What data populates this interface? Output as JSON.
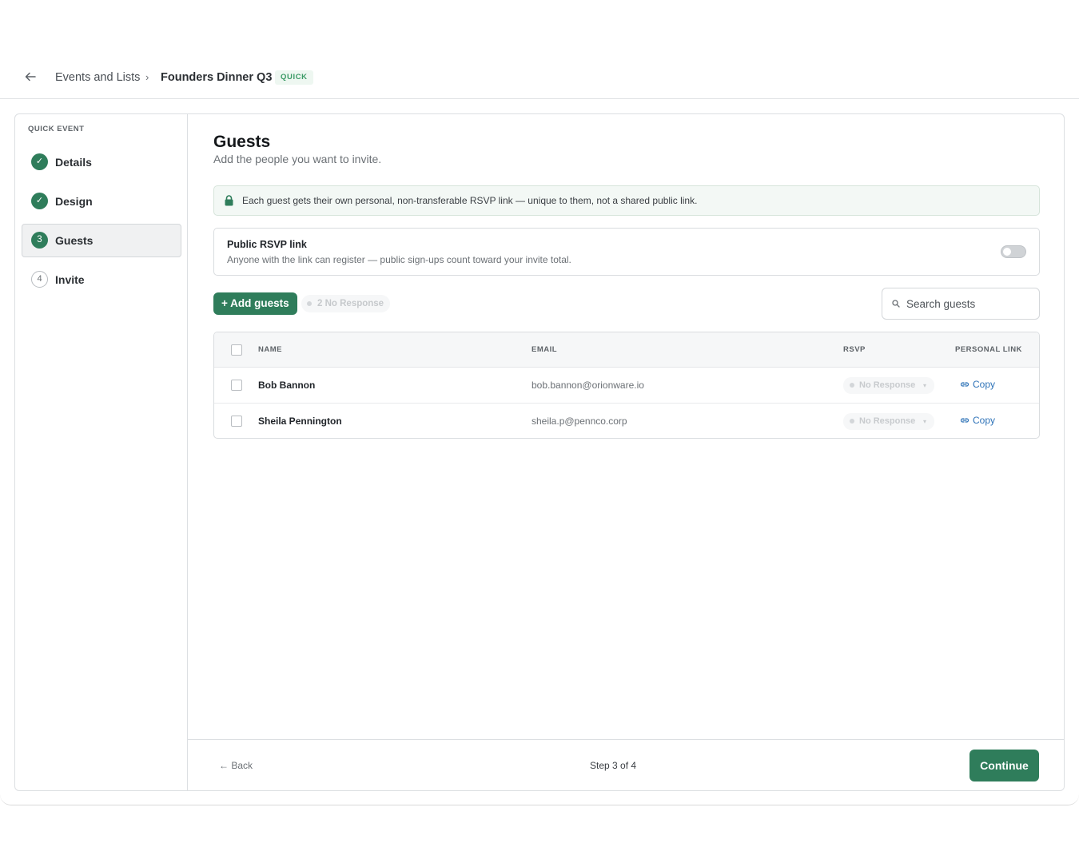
{
  "header": {
    "breadcrumb_root": "Events and Lists",
    "breadcrumb_sep": "›",
    "breadcrumb_current": "Founders Dinner Q3",
    "badge": "QUICK"
  },
  "sidebar": {
    "title": "QUICK EVENT",
    "steps": [
      {
        "label": "Details",
        "state": "done",
        "marker": "✓"
      },
      {
        "label": "Design",
        "state": "done",
        "marker": "✓"
      },
      {
        "label": "Guests",
        "state": "current",
        "marker": "3"
      },
      {
        "label": "Invite",
        "state": "todo",
        "marker": "4"
      }
    ]
  },
  "main": {
    "title": "Guests",
    "subtitle": "Add the people you want to invite.",
    "notice": "Each guest gets their own personal, non-transferable RSVP link — unique to them, not a shared public link.",
    "public_rsvp": {
      "title": "Public RSVP link",
      "description": "Anyone with the link can register — public sign-ups count toward your invite total.",
      "enabled": false
    },
    "add_button": "+ Add guests",
    "filter_pill": "2 No Response",
    "search": {
      "placeholder": "Search guests"
    },
    "table": {
      "columns": [
        "NAME",
        "EMAIL",
        "RSVP",
        "PERSONAL LINK"
      ],
      "rows": [
        {
          "name": "Bob Bannon",
          "email": "bob.bannon@orionware.io",
          "rsvp": "No Response",
          "link": "Copy"
        },
        {
          "name": "Sheila Pennington",
          "email": "sheila.p@pennco.corp",
          "rsvp": "No Response",
          "link": "Copy"
        }
      ]
    }
  },
  "footer": {
    "back": "← Back",
    "step": "Step 3 of 4",
    "continue": "Continue"
  },
  "colors": {
    "accent": "#2f7d5b",
    "link": "#2f73b8",
    "badge_text": "#3b9a65"
  }
}
